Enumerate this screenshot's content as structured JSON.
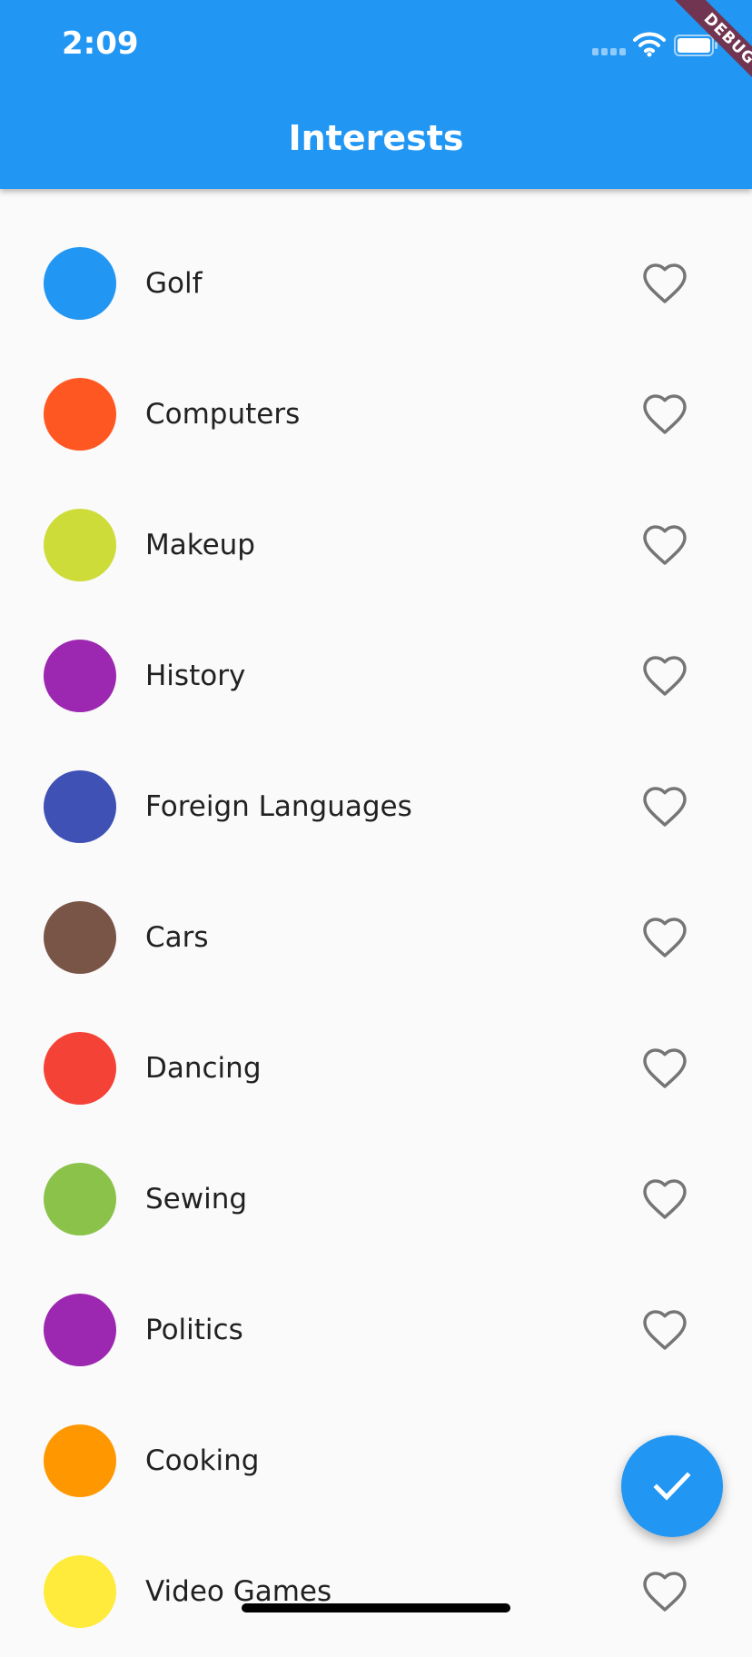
{
  "status_bar": {
    "time": "2:09"
  },
  "app_bar": {
    "title": "Interests",
    "color": "#2196f3"
  },
  "debug_banner": {
    "text": "DEBUG"
  },
  "interests": [
    {
      "label": "Golf",
      "color": "#2196f3",
      "icon": "heart-outline-icon",
      "favorited": false
    },
    {
      "label": "Computers",
      "color": "#ff5722",
      "icon": "heart-outline-icon",
      "favorited": false
    },
    {
      "label": "Makeup",
      "color": "#cddc39",
      "icon": "heart-outline-icon",
      "favorited": false
    },
    {
      "label": "History",
      "color": "#9c27b0",
      "icon": "heart-outline-icon",
      "favorited": false
    },
    {
      "label": "Foreign Languages",
      "color": "#3f51b5",
      "icon": "heart-outline-icon",
      "favorited": false
    },
    {
      "label": "Cars",
      "color": "#795548",
      "icon": "heart-outline-icon",
      "favorited": false
    },
    {
      "label": "Dancing",
      "color": "#f44336",
      "icon": "heart-outline-icon",
      "favorited": false
    },
    {
      "label": "Sewing",
      "color": "#8bc34a",
      "icon": "heart-outline-icon",
      "favorited": false
    },
    {
      "label": "Politics",
      "color": "#9c27b0",
      "icon": "heart-outline-icon",
      "favorited": false
    },
    {
      "label": "Cooking",
      "color": "#ff9800",
      "icon": "heart-outline-icon",
      "favorited": false
    },
    {
      "label": "Video Games",
      "color": "#ffeb3b",
      "icon": "heart-outline-icon",
      "favorited": false
    }
  ],
  "fab": {
    "icon": "check-icon",
    "color": "#2196f3"
  }
}
